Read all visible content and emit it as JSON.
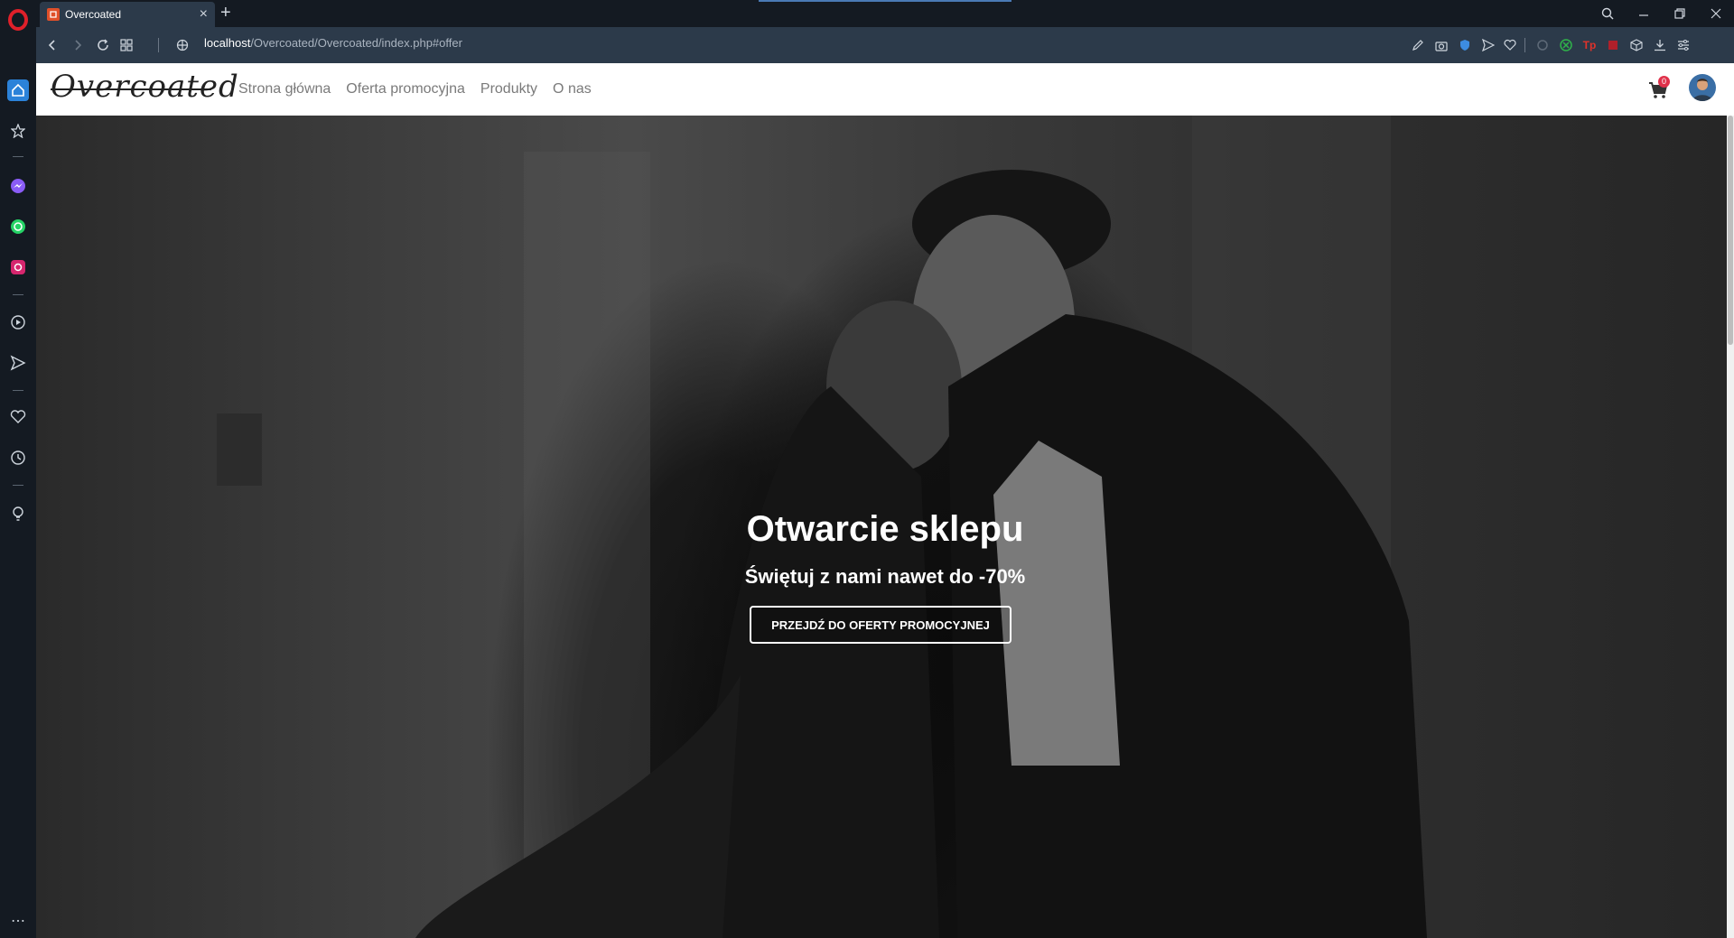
{
  "browser": {
    "tab_title": "Overcoated",
    "new_tab_label": "+",
    "close_tab_label": "×",
    "url_host": "localhost",
    "url_path": "/Overcoated/Overcoated/index.php#offer",
    "accent": "#e0502a"
  },
  "site": {
    "brand": "Overcoated",
    "nav": [
      {
        "label": "Strona główna"
      },
      {
        "label": "Oferta promocyjna"
      },
      {
        "label": "Produkty"
      },
      {
        "label": "O nas"
      }
    ],
    "cart_count": "0"
  },
  "hero": {
    "title": "Otwarcie sklepu",
    "subtitle": "Świętuj z nami nawet do -70%",
    "button": "PRZEJDŹ DO OFERTY PROMOCYJNEJ"
  }
}
